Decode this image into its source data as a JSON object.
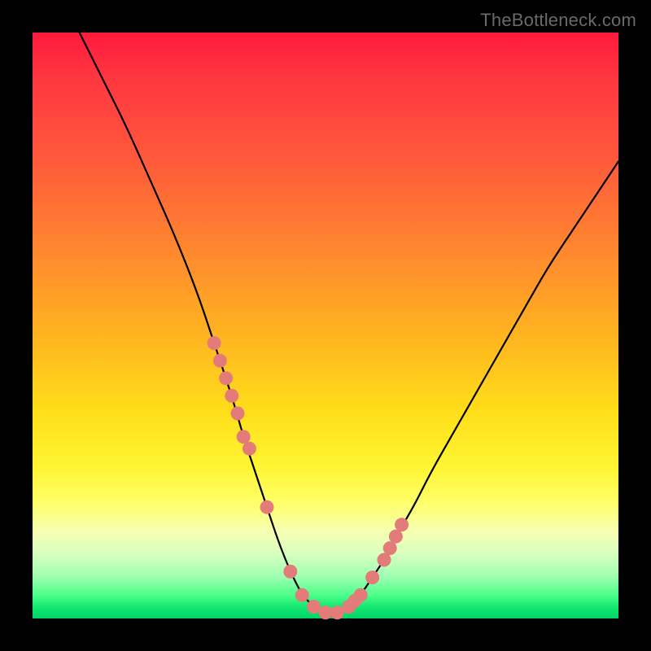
{
  "watermark": "TheBottleneck.com",
  "chart_data": {
    "type": "line",
    "title": "",
    "xlabel": "",
    "ylabel": "",
    "xlim": [
      0,
      100
    ],
    "ylim": [
      0,
      100
    ],
    "curve": {
      "name": "bottleneck_curve",
      "description": "V-shaped curve dipping toward zero near x≈50 then rising again; no numeric axes shown",
      "x": [
        8,
        12,
        16,
        20,
        24,
        28,
        31,
        34,
        36,
        38,
        40,
        42,
        44,
        46,
        48,
        50,
        52,
        54,
        56,
        58,
        60,
        62,
        65,
        68,
        72,
        76,
        80,
        84,
        88,
        92,
        96,
        100
      ],
      "y": [
        100,
        92,
        84,
        75,
        66,
        56,
        47,
        38,
        31,
        25,
        19,
        13,
        8,
        4,
        2,
        1,
        1,
        2,
        4,
        7,
        10,
        14,
        19,
        25,
        32,
        39,
        46,
        53,
        60,
        66,
        72,
        78
      ]
    },
    "markers": {
      "name": "highlighted_points",
      "color": "#e47b7b",
      "x": [
        31,
        32,
        33,
        34,
        35,
        36,
        37,
        40,
        44,
        46,
        48,
        50,
        52,
        54,
        55,
        56,
        58,
        60,
        61,
        62,
        63
      ],
      "y": [
        47,
        44,
        41,
        38,
        35,
        31,
        29,
        19,
        8,
        4,
        2,
        1,
        1,
        2,
        3,
        4,
        7,
        10,
        12,
        14,
        16
      ]
    }
  },
  "colors": {
    "frame": "#000000",
    "curve": "#000000",
    "marker_fill": "#e47b7b",
    "marker_stroke": "#d46565"
  }
}
